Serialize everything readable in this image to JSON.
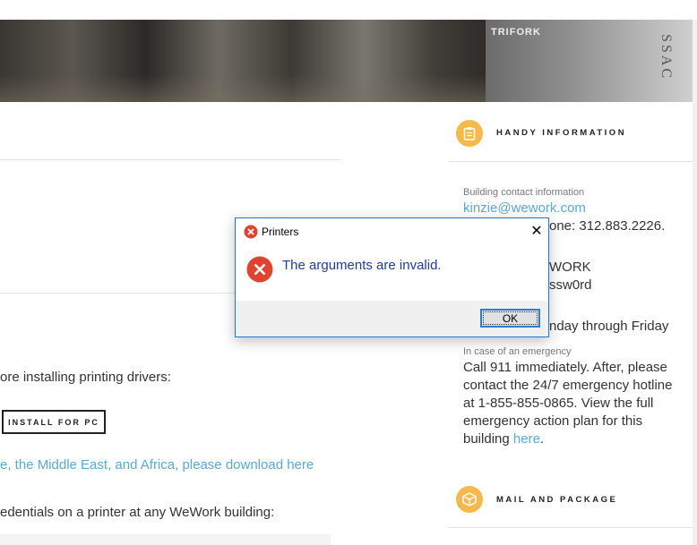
{
  "hero": {
    "sign_text": "TRIFORK",
    "side_text": "SSAC"
  },
  "main": {
    "intro_text": "ore installing printing drivers:",
    "install_button": "INSTALL FOR PC",
    "region_link": "e, the Middle East, and Africa, please download here",
    "credentials_text": "edentials on a printer at any WeWork building:"
  },
  "sidebar": {
    "handy_heading": "HANDY INFORMATION",
    "contact_label": "Building contact information",
    "contact_email": "kinzie@wework.com",
    "phone_partial": "one: 312.883.2226.",
    "wifi_name_partial": "WORK",
    "wifi_pass_partial": "ssw0rd",
    "hours_partial": "nday through Friday",
    "emergency_label": "In case of an emergency",
    "emergency_text": "Call 911 immediately. After, please contact the 24/7 emergency hotline at 1-855-855-0865. View the full emergency action plan for this building",
    "emergency_link": "here",
    "emergency_end": ".",
    "mail_heading": "MAIL AND PACKAGE"
  },
  "dialog": {
    "title": "Printers",
    "message": "The arguments are invalid.",
    "ok_label": "OK",
    "close_glyph": "✕"
  },
  "colors": {
    "accent": "#5aa9cf",
    "icon_bg": "#f6b94b",
    "dialog_text": "#1f3d99",
    "error_red": "#e0432f"
  }
}
